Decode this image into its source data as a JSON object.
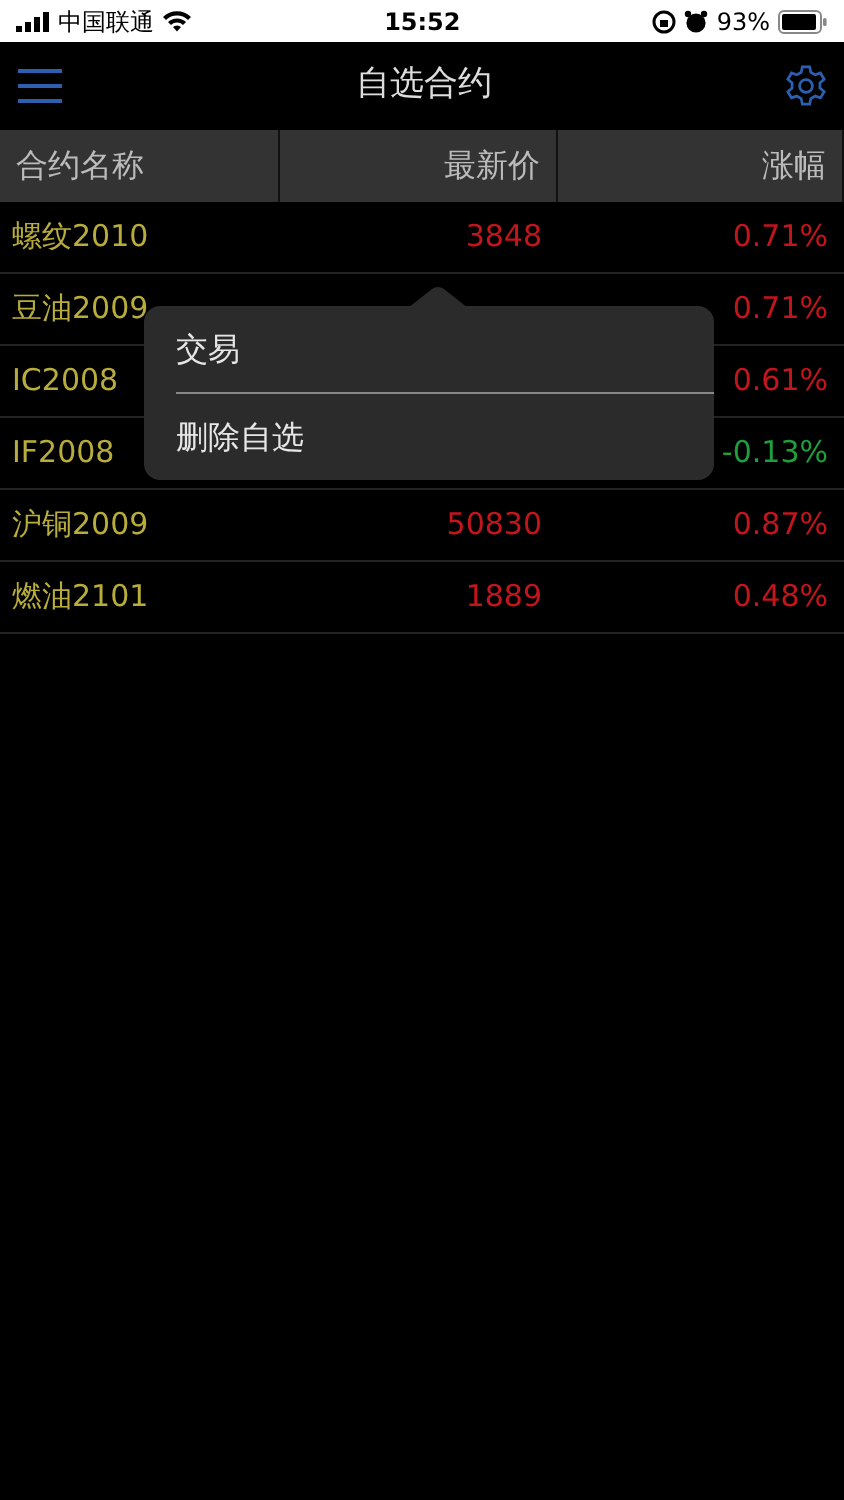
{
  "status_bar": {
    "carrier": "中国联通",
    "time": "15:52",
    "battery": "93%"
  },
  "nav": {
    "title": "自选合约"
  },
  "table": {
    "columns": [
      "合约名称",
      "最新价",
      "涨幅"
    ],
    "rows": [
      {
        "name": "螺纹2010",
        "price": "3848",
        "change": "0.71%",
        "kind": "up"
      },
      {
        "name": "豆油2009",
        "change": "0.71%",
        "kind": "up"
      },
      {
        "name": "IC2008",
        "change": "0.61%",
        "kind": "up"
      },
      {
        "name": "IF2008",
        "change": "-0.13%",
        "kind": "down"
      },
      {
        "name": "沪铜2009",
        "price": "50830",
        "change": "0.87%",
        "kind": "up"
      },
      {
        "name": "燃油2101",
        "price": "1889",
        "change": "0.48%",
        "kind": "up"
      }
    ]
  },
  "popup_menu": {
    "items": [
      "交易",
      "删除自选"
    ]
  }
}
